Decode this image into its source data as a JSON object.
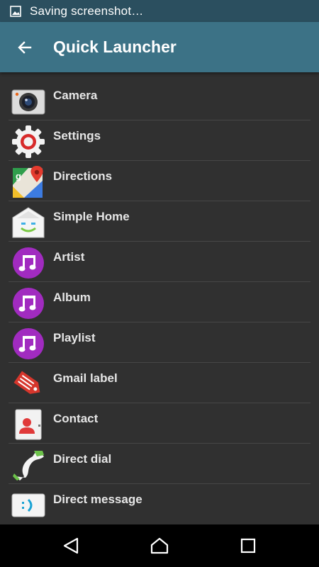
{
  "status_bar": {
    "text": "Saving screenshot…",
    "icon": "image-icon"
  },
  "app_bar": {
    "title": "Quick Launcher",
    "back_icon": "arrow-left-icon"
  },
  "list": {
    "items": [
      {
        "label": "Camera",
        "icon": "camera-icon"
      },
      {
        "label": "Settings",
        "icon": "settings-gear-icon"
      },
      {
        "label": "Directions",
        "icon": "maps-directions-icon"
      },
      {
        "label": "Simple Home",
        "icon": "simple-home-icon"
      },
      {
        "label": "Artist",
        "icon": "music-note-icon"
      },
      {
        "label": "Album",
        "icon": "music-note-icon"
      },
      {
        "label": "Playlist",
        "icon": "music-note-icon"
      },
      {
        "label": "Gmail label",
        "icon": "gmail-label-icon"
      },
      {
        "label": "Contact",
        "icon": "contact-icon"
      },
      {
        "label": "Direct dial",
        "icon": "phone-icon"
      },
      {
        "label": "Direct message",
        "icon": "message-icon"
      }
    ]
  },
  "nav_bar": {
    "back": "back-icon",
    "home": "home-icon",
    "recents": "recents-icon"
  },
  "colors": {
    "status_bar": "#2b4f5f",
    "app_bar": "#3c7286",
    "background": "#303030",
    "music_purple": "#a12bc0"
  }
}
